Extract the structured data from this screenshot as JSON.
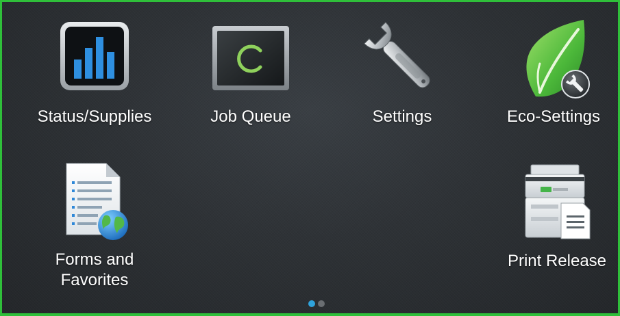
{
  "home": {
    "apps": [
      {
        "label": "Status/Supplies",
        "icon": "bar-chart-icon"
      },
      {
        "label": "Job Queue",
        "icon": "job-queue-icon"
      },
      {
        "label": "Settings",
        "icon": "wrench-icon"
      },
      {
        "label": "Eco-Settings",
        "icon": "leaf-wrench-icon"
      },
      {
        "label_line1": "Forms and",
        "label_line2": "Favorites",
        "icon": "forms-globe-icon"
      },
      {
        "label": "Print Release",
        "icon": "printer-document-icon"
      }
    ],
    "pager": {
      "current": 1,
      "total": 2
    }
  },
  "colors": {
    "frame": "#2fbf3a",
    "background": "#2e3236",
    "label": "#ffffff",
    "active_dot": "#2fa3dc",
    "inactive_dot": "#6a6e72"
  }
}
